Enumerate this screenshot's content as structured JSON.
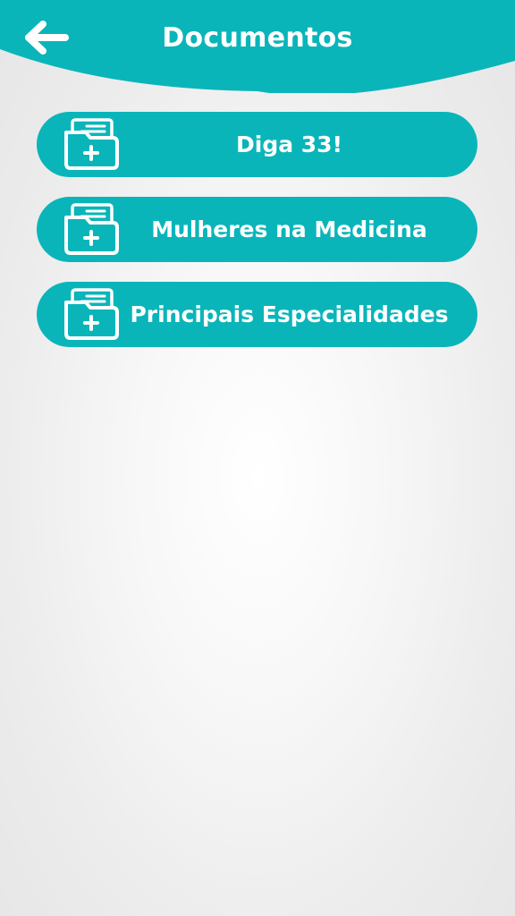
{
  "colors": {
    "accent": "#0ab5ba",
    "text_on_accent": "#ffffff",
    "background": "#f2f2f2"
  },
  "header": {
    "title": "Documentos",
    "back_icon": "arrow-left-icon"
  },
  "documents": [
    {
      "label": "Diga 33!",
      "icon": "folder-plus-icon"
    },
    {
      "label": "Mulheres na Medicina",
      "icon": "folder-plus-icon"
    },
    {
      "label": "Principais Especialidades",
      "icon": "folder-plus-icon"
    }
  ]
}
